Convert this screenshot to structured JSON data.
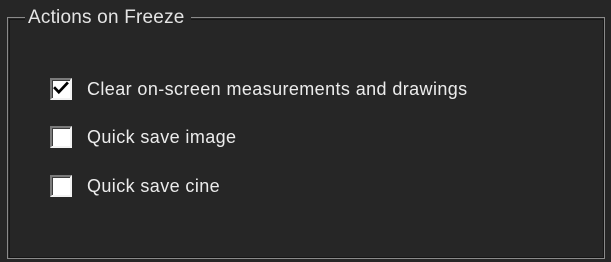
{
  "group": {
    "title": "Actions on Freeze"
  },
  "options": [
    {
      "label": "Clear on-screen measurements and drawings",
      "checked": true
    },
    {
      "label": "Quick save image",
      "checked": false
    },
    {
      "label": "Quick save cine",
      "checked": false
    }
  ],
  "colors": {
    "background": "#262626",
    "text": "#ececec",
    "checkbox_fill": "#ffffff",
    "checkmark": "#000000"
  },
  "icons": {
    "check": "checkmark-icon"
  }
}
